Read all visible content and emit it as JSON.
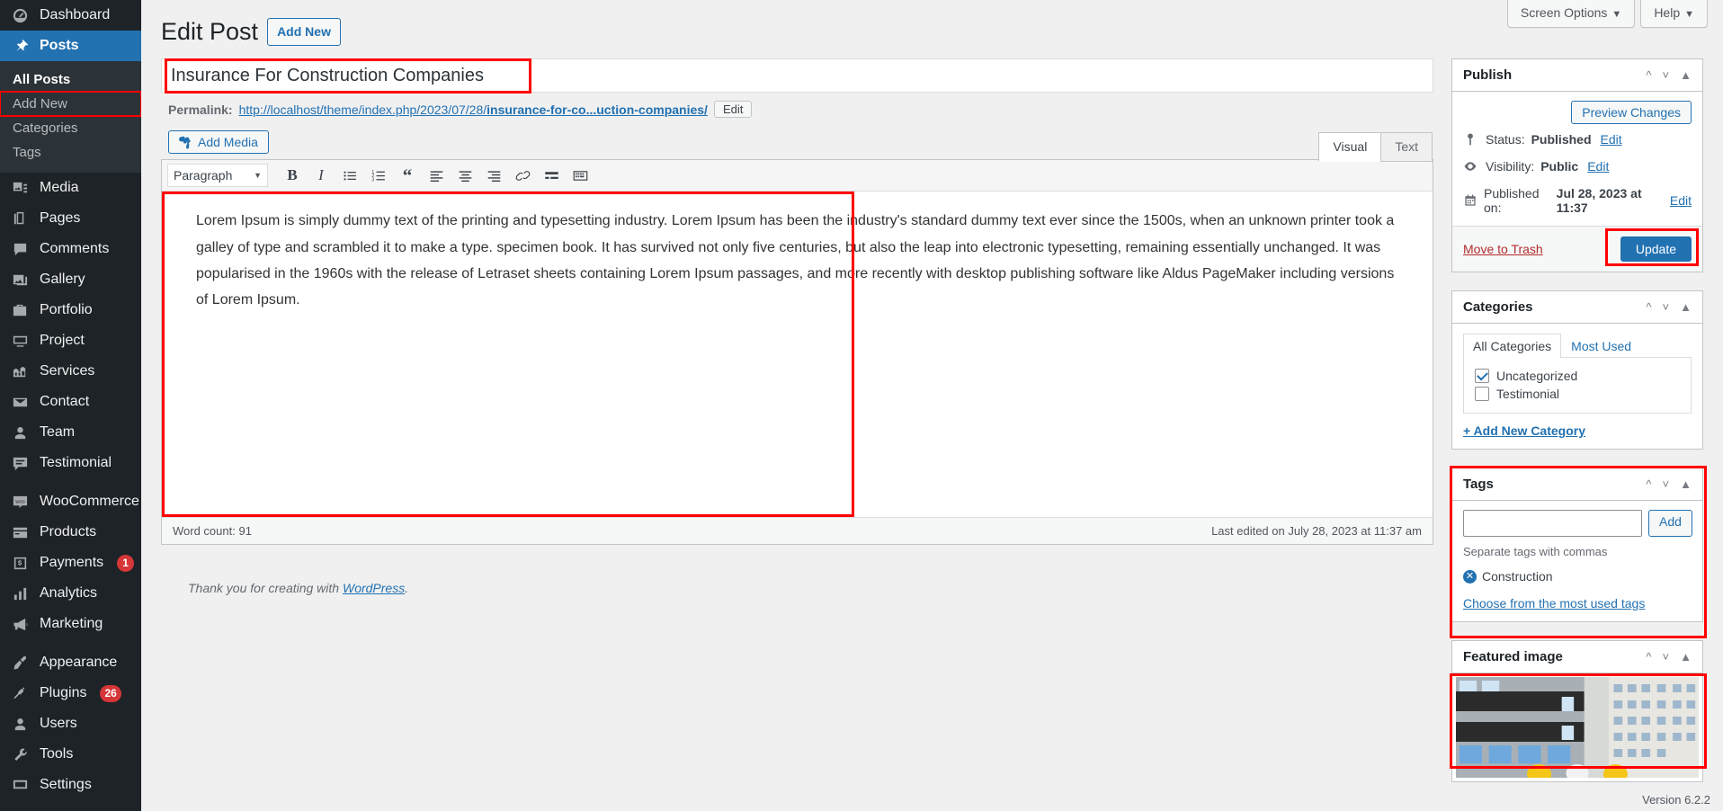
{
  "sidebar": {
    "items": [
      {
        "label": "Dashboard",
        "icon": "dashboard-icon",
        "name": "dashboard"
      },
      {
        "label": "Posts",
        "icon": "pin-icon",
        "name": "posts",
        "current": true
      },
      {
        "label": "Media",
        "icon": "media-icon",
        "name": "media"
      },
      {
        "label": "Pages",
        "icon": "pages-icon",
        "name": "pages"
      },
      {
        "label": "Comments",
        "icon": "comments-icon",
        "name": "comments"
      },
      {
        "label": "Gallery",
        "icon": "gallery-icon",
        "name": "gallery"
      },
      {
        "label": "Portfolio",
        "icon": "portfolio-icon",
        "name": "portfolio"
      },
      {
        "label": "Project",
        "icon": "project-icon",
        "name": "project"
      },
      {
        "label": "Services",
        "icon": "services-icon",
        "name": "services"
      },
      {
        "label": "Contact",
        "icon": "envelope-icon",
        "name": "contact"
      },
      {
        "label": "Team",
        "icon": "user-icon",
        "name": "team"
      },
      {
        "label": "Testimonial",
        "icon": "testimonial-icon",
        "name": "testimonial"
      },
      {
        "label": "WooCommerce",
        "icon": "woo-icon",
        "name": "woocommerce",
        "sep_before": true
      },
      {
        "label": "Products",
        "icon": "products-icon",
        "name": "products"
      },
      {
        "label": "Payments",
        "icon": "payments-icon",
        "name": "payments",
        "badge": "1"
      },
      {
        "label": "Analytics",
        "icon": "analytics-icon",
        "name": "analytics"
      },
      {
        "label": "Marketing",
        "icon": "marketing-icon",
        "name": "marketing"
      },
      {
        "label": "Appearance",
        "icon": "appearance-icon",
        "name": "appearance",
        "sep_before": true
      },
      {
        "label": "Plugins",
        "icon": "plugins-icon",
        "name": "plugins",
        "badge": "26"
      },
      {
        "label": "Users",
        "icon": "users-icon",
        "name": "users"
      },
      {
        "label": "Tools",
        "icon": "tools-icon",
        "name": "tools"
      },
      {
        "label": "Settings",
        "icon": "settings-icon",
        "name": "settings"
      }
    ],
    "posts_submenu": [
      {
        "label": "All Posts",
        "current": true,
        "outlined": false
      },
      {
        "label": "Add New",
        "current": false,
        "outlined": true
      },
      {
        "label": "Categories",
        "current": false,
        "outlined": false
      },
      {
        "label": "Tags",
        "current": false,
        "outlined": false
      }
    ]
  },
  "screen_meta": {
    "screen_options": "Screen Options",
    "help": "Help",
    "caret": "▼"
  },
  "page": {
    "title": "Edit Post",
    "add_new": "Add New"
  },
  "post": {
    "title_value": "Insurance For Construction Companies",
    "title_placeholder": "Add title",
    "permalink_label": "Permalink:",
    "permalink_prefix": "http://localhost/theme/index.php/2023/07/28/",
    "permalink_slug": "insurance-for-co...uction-companies/",
    "permalink_edit": "Edit"
  },
  "editor": {
    "add_media": "Add Media",
    "tabs": [
      {
        "label": "Visual",
        "active": true
      },
      {
        "label": "Text",
        "active": false
      }
    ],
    "format_select": "Paragraph",
    "toolbar_buttons": [
      "bold-icon",
      "italic-icon",
      "bulleted-list-icon",
      "numbered-list-icon",
      "blockquote-icon",
      "align-left-icon",
      "align-center-icon",
      "align-right-icon",
      "link-icon",
      "read-more-icon",
      "toolbar-toggle-icon"
    ],
    "content": "Lorem Ipsum is simply dummy text of the printing and typesetting industry. Lorem Ipsum has been the industry's standard dummy text ever since the 1500s, when an unknown printer took a galley of type and scrambled it to make a type. specimen book. It has survived not only five centuries, but also the leap into electronic typesetting, remaining essentially unchanged. It was popularised in the 1960s with the release of Letraset sheets containing Lorem Ipsum passages, and more recently with desktop publishing software like Aldus PageMaker including versions of Lorem Ipsum.",
    "word_count": "Word count: 91",
    "last_edited": "Last edited on July 28, 2023 at 11:37 am"
  },
  "publish": {
    "title": "Publish",
    "preview_changes": "Preview Changes",
    "status_label": "Status:",
    "status_value": "Published",
    "status_edit": "Edit",
    "visibility_label": "Visibility:",
    "visibility_value": "Public",
    "visibility_edit": "Edit",
    "published_label": "Published on:",
    "published_value": "Jul 28, 2023 at 11:37",
    "published_edit": "Edit",
    "move_to_trash": "Move to Trash",
    "update": "Update"
  },
  "categories": {
    "title": "Categories",
    "tabs": [
      {
        "label": "All Categories",
        "active": true
      },
      {
        "label": "Most Used",
        "active": false
      }
    ],
    "items": [
      {
        "label": "Uncategorized",
        "checked": true
      },
      {
        "label": "Testimonial",
        "checked": false
      }
    ],
    "add_new": "+ Add New Category"
  },
  "tags": {
    "title": "Tags",
    "input_value": "",
    "input_placeholder": "",
    "add_button": "Add",
    "hint": "Separate tags with commas",
    "chips": [
      "Construction"
    ],
    "most_used": "Choose from the most used tags"
  },
  "featured_image": {
    "title": "Featured image",
    "alt": "construction-site-photo"
  },
  "footer": {
    "thank_you_prefix": "Thank you for creating with ",
    "wordpress": "WordPress",
    "thank_you_suffix": ".",
    "version": "Version 6.2.2"
  },
  "colors": {
    "accent": "#2271b1",
    "sidebar_bg": "#1d2327",
    "annotation": "#ff0000",
    "danger": "#d63638"
  }
}
